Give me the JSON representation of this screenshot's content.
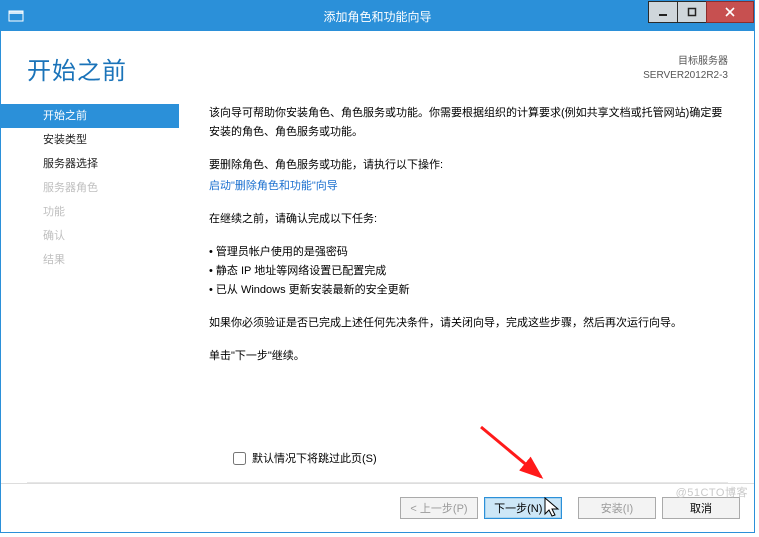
{
  "window": {
    "title": "添加角色和功能向导"
  },
  "header": {
    "page_title": "开始之前",
    "target_label": "目标服务器",
    "target_server": "SERVER2012R2-3"
  },
  "nav": {
    "items": [
      {
        "label": "开始之前",
        "state": "active"
      },
      {
        "label": "安装类型",
        "state": "enabled"
      },
      {
        "label": "服务器选择",
        "state": "enabled"
      },
      {
        "label": "服务器角色",
        "state": "disabled"
      },
      {
        "label": "功能",
        "state": "disabled"
      },
      {
        "label": "确认",
        "state": "disabled"
      },
      {
        "label": "结果",
        "state": "disabled"
      }
    ]
  },
  "content": {
    "intro": "该向导可帮助你安装角色、角色服务或功能。你需要根据组织的计算要求(例如共享文档或托管网站)确定要安装的角色、角色服务或功能。",
    "remove_prompt": "要删除角色、角色服务或功能，请执行以下操作:",
    "remove_link": "启动\"删除角色和功能\"向导",
    "before_continue": "在继续之前，请确认完成以下任务:",
    "bullets": [
      "管理员帐户使用的是强密码",
      "静态 IP 地址等网络设置已配置完成",
      "已从 Windows 更新安装最新的安全更新"
    ],
    "verify": "如果你必须验证是否已完成上述任何先决条件，请关闭向导，完成这些步骤，然后再次运行向导。",
    "next_hint": "单击\"下一步\"继续。",
    "skip_checkbox": "默认情况下将跳过此页(S)"
  },
  "footer": {
    "prev": "< 上一步(P)",
    "next": "下一步(N) >",
    "install": "安装(I)",
    "cancel": "取消"
  },
  "watermark": "@51CTO博客"
}
